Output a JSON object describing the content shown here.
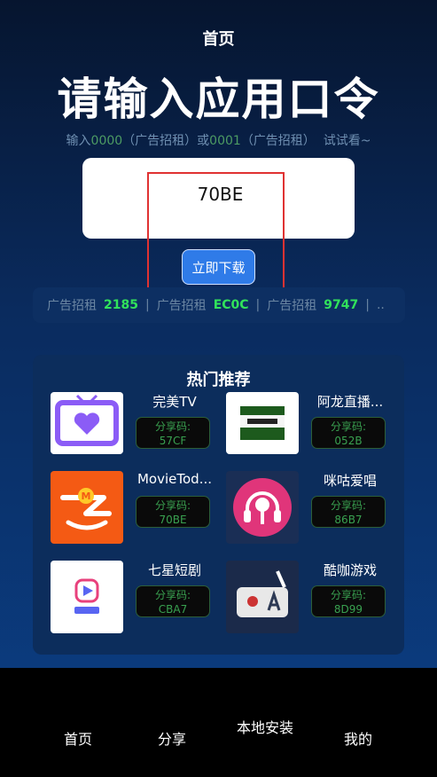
{
  "header": {
    "title": "首页"
  },
  "hero": {
    "title": "请输入应用口令"
  },
  "hint": {
    "prefix": "输入",
    "code1": "0000",
    "mid1": "（广告招租）或",
    "code2": "0001",
    "mid2": "（广告招租）",
    "suffix": "试试看~"
  },
  "input": {
    "value": "70BE"
  },
  "download_button": "立即下载",
  "ticker": [
    {
      "label": "广告招租",
      "code": "2185"
    },
    {
      "label": "广告招租",
      "code": "EC0C"
    },
    {
      "label": "广告招租",
      "code": "9747"
    }
  ],
  "ticker_tail": "..",
  "hot": {
    "title": "热门推荐",
    "share_label": "分享码:",
    "apps": [
      {
        "name": "完美TV",
        "code": "57CF",
        "icon": "tv-heart-icon"
      },
      {
        "name": "阿龙直播...",
        "code": "052B",
        "icon": "alonglive-logo-icon"
      },
      {
        "name": "MovieTod...",
        "code": "70BE",
        "icon": "movietoday-logo-icon"
      },
      {
        "name": "咪咕爱唱",
        "code": "86B7",
        "icon": "microphone-headphone-icon"
      },
      {
        "name": "七星短剧",
        "code": "CBA7",
        "icon": "qixing-play-icon"
      },
      {
        "name": "酷咖游戏",
        "code": "8D99",
        "icon": "game-robot-icon"
      }
    ]
  },
  "tabbar": {
    "items": [
      "首页",
      "分享",
      "本地安装",
      "我的"
    ]
  }
}
